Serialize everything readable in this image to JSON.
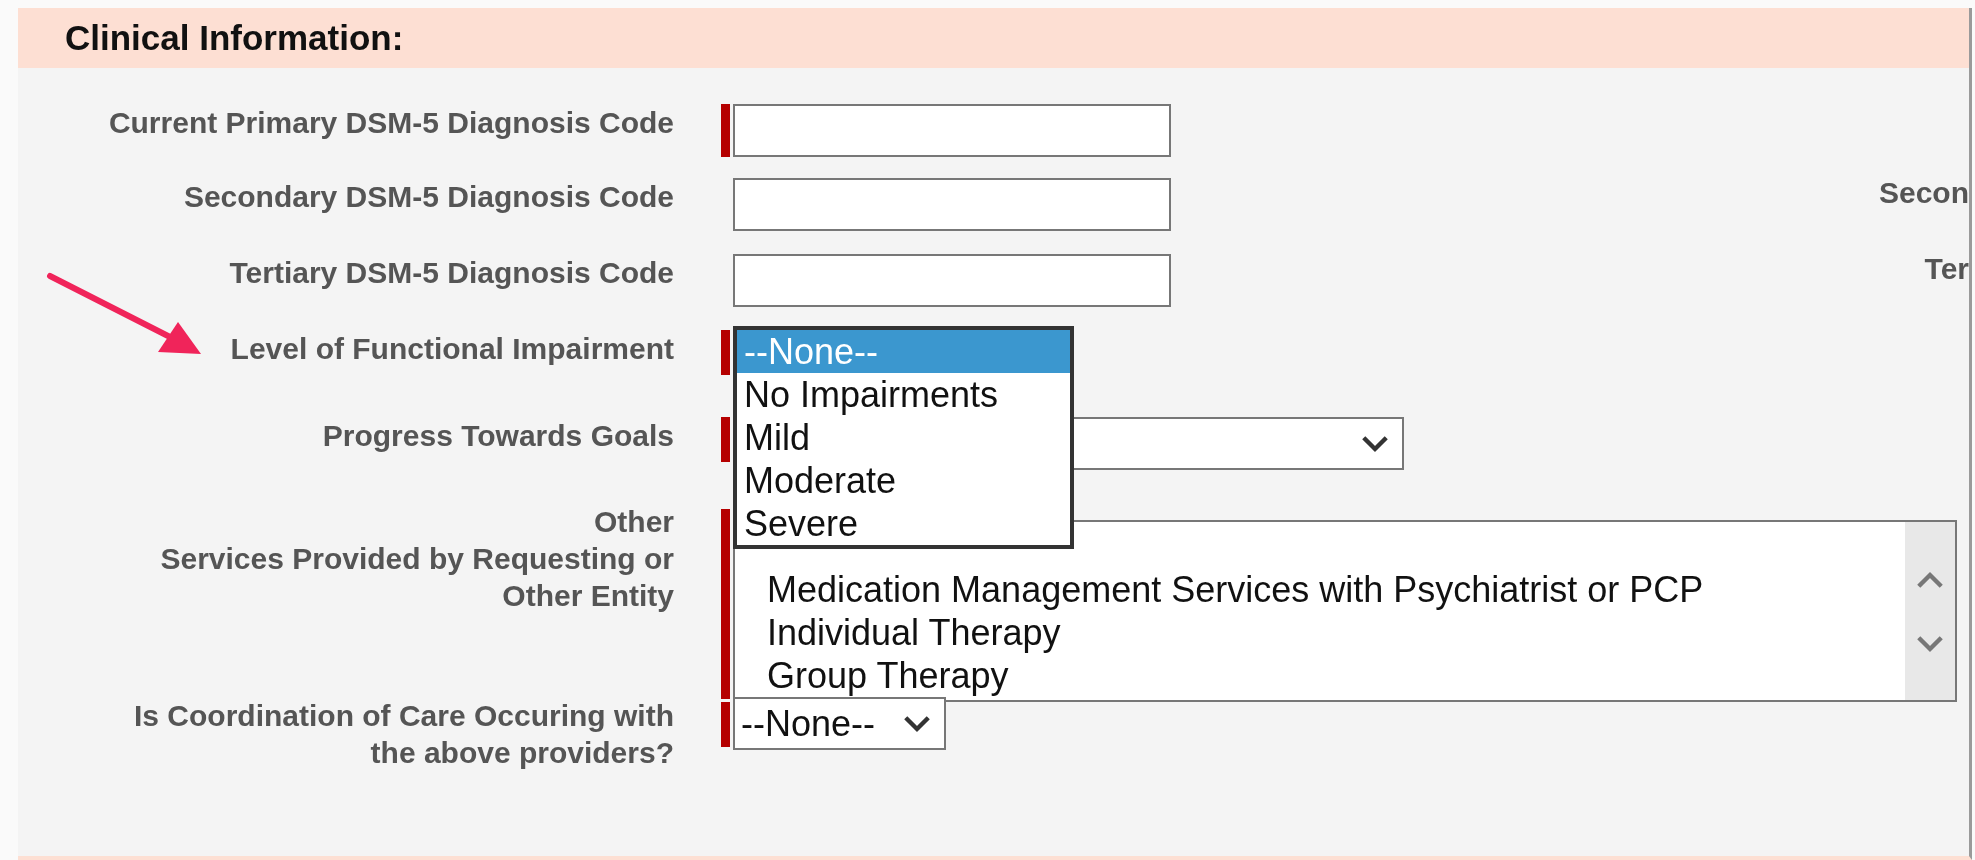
{
  "section": {
    "title": "Clinical Information:"
  },
  "fields": [
    {
      "kind": "text",
      "label": "Current Primary DSM-5 Diagnosis Code",
      "required": true
    },
    {
      "kind": "text",
      "label": "Secondary DSM-5 Diagnosis Code",
      "required": false,
      "side_label": "Secon"
    },
    {
      "kind": "text",
      "label": "Tertiary DSM-5 Diagnosis Code",
      "required": false,
      "side_label": "Ter"
    },
    {
      "kind": "dropdown_open",
      "label": "Level of Functional Impairment",
      "required": true,
      "options": [
        {
          "label": "--None--",
          "selected": true
        },
        {
          "label": "No Impairments",
          "selected": false
        },
        {
          "label": "Mild",
          "selected": false
        },
        {
          "label": "Moderate",
          "selected": false
        },
        {
          "label": "Severe",
          "selected": false
        }
      ]
    },
    {
      "kind": "select",
      "label": "Progress Towards Goals",
      "required": true
    },
    {
      "kind": "multiselect",
      "label": "Other\nServices Provided by Requesting or\nOther Entity",
      "required": true,
      "options": [
        {
          "label": "Medication Management Services with Psychiatrist or PCP"
        },
        {
          "label": "Individual Therapy"
        },
        {
          "label": "Group Therapy"
        }
      ]
    },
    {
      "kind": "select",
      "label": "Is Coordination of Care Occuring with\nthe above providers?",
      "required": true,
      "value": "--None--"
    }
  ]
}
